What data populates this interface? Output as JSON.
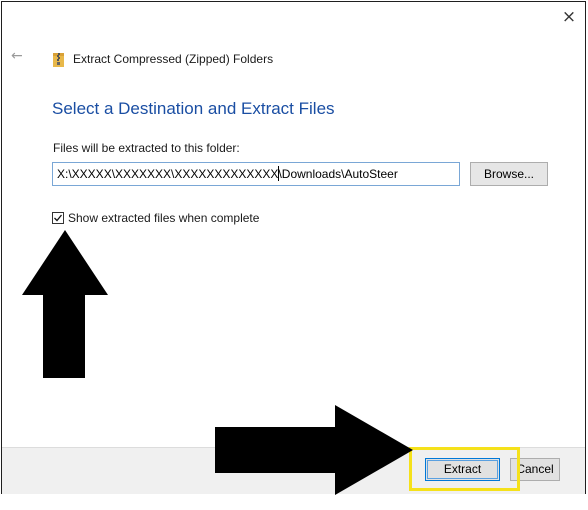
{
  "window": {
    "close_glyph": "×"
  },
  "nav": {
    "back_glyph": "←",
    "title": "Extract Compressed (Zipped) Folders"
  },
  "main": {
    "heading": "Select a Destination and Extract Files",
    "field_label": "Files will be extracted to this folder:",
    "path_before_caret": "X:\\XXXXX\\XXXXXXX\\XXXXXXXXXXXXX",
    "path_after_caret": "\\Downloads\\AutoSteer",
    "browse_label": "Browse...",
    "checkbox_label": "Show extracted files when complete",
    "checkbox_checked": true
  },
  "footer": {
    "extract_label": "Extract",
    "cancel_label": "Cancel"
  },
  "colors": {
    "heading": "#1a4ea3",
    "highlight": "#f5e11a",
    "annotation_arrow": "#000000",
    "focus_border": "#0078d7"
  },
  "icons": {
    "close": "close-icon",
    "back": "back-arrow-icon",
    "zip": "zip-folder-icon",
    "check": "checkmark-icon"
  }
}
